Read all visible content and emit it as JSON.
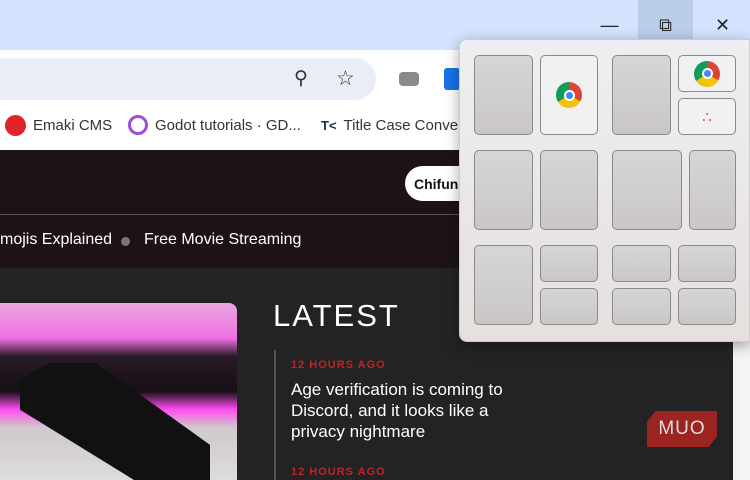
{
  "window": {
    "controls": [
      "minimize",
      "restore",
      "close"
    ]
  },
  "toolbar": {
    "icons": [
      "zoom-out-icon",
      "star-icon"
    ]
  },
  "bookmarks": [
    {
      "label": "Emaki CMS"
    },
    {
      "label": "Godot tutorials · GD..."
    },
    {
      "label": "Title Case Conve"
    }
  ],
  "site": {
    "user_pill": "Chifund",
    "trending": [
      "mojis Explained",
      "Free Movie Streaming"
    ],
    "latest_heading": "LATEST",
    "articles": [
      {
        "time": "12 HOURS AGO",
        "title": "Age verification is coming to Discord, and it looks like a privacy nightmare"
      },
      {
        "time": "12 HOURS AGO"
      }
    ],
    "logo": "MUO"
  },
  "snap_layouts": {
    "layouts": [
      "half-half",
      "half-quarters",
      "half-half-2",
      "two-thirds",
      "half-quarters-2",
      "quarters"
    ]
  },
  "colors": {
    "titlebar": "#d3e3fd",
    "accent": "#b8262a",
    "nav": "#1e1314"
  }
}
